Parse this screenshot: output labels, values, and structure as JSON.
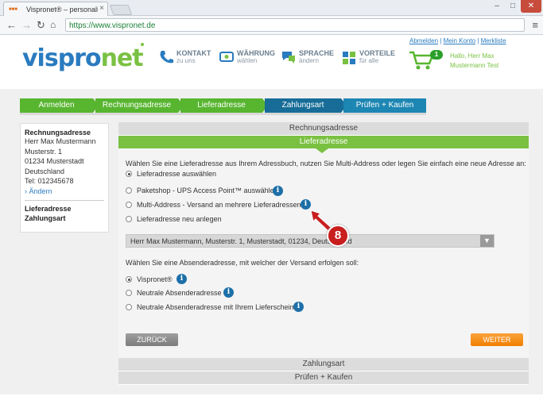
{
  "browser": {
    "tab_title": "Vispronet® – personalisi",
    "tab_favicon": "■■■",
    "url": "https://www.vispronet.de",
    "icons": {
      "back": "arrow-left-icon",
      "forward": "arrow-right-icon",
      "reload": "reload-icon",
      "home": "home-icon",
      "menu": "hamburger-menu-icon",
      "close_tab": "close-icon"
    }
  },
  "header": {
    "logo_vispro": "vispro",
    "logo_net": "net",
    "nav": [
      {
        "title": "KONTAKT",
        "sub": "zu uns",
        "icon": "phone-icon"
      },
      {
        "title": "WÄHRUNG",
        "sub": "wählen",
        "icon": "currency-icon"
      },
      {
        "title": "SPRACHE",
        "sub": "ändern",
        "icon": "language-icon"
      },
      {
        "title": "VORTEILE",
        "sub": "für alle",
        "icon": "advantages-icon"
      }
    ],
    "toplinks": [
      "Abmelden",
      "Mein Konto",
      "Merkliste"
    ],
    "toplink_sep": "|",
    "cart_count": "1",
    "greeting_line1": "Hallo, Herr Max",
    "greeting_line2": "Mustermann Test"
  },
  "steps": [
    "Anmelden",
    "Rechnungsadresse",
    "Lieferadresse",
    "Zahlungsart",
    "Prüfen + Kaufen"
  ],
  "sidebar": {
    "billing_title": "Rechnungsadresse",
    "billing_lines": [
      "Herr Max Mustermann",
      "Musterstr. 1",
      "01234 Musterstadt",
      "Deutschland",
      "Tel: 012345678"
    ],
    "change_link": "› Ändern",
    "delivery_title": "Lieferadresse",
    "payment_title": "Zahlungsart"
  },
  "panel": {
    "billing_head": "Rechnungsadresse",
    "delivery_head": "Lieferadresse",
    "intro": "Wählen Sie eine Lieferadresse aus Ihrem Adressbuch, nutzen Sie Multi-Address oder legen Sie einfach eine neue Adresse an:",
    "options": [
      {
        "label": "Lieferadresse auswählen",
        "selected": true,
        "info": false
      },
      {
        "label": "Paketshop - UPS Access Point™ auswählen",
        "selected": false,
        "info": true
      },
      {
        "label": "Multi-Address - Versand an mehrere Lieferadressen",
        "selected": false,
        "info": true
      },
      {
        "label": "Lieferadresse neu anlegen",
        "selected": false,
        "info": false
      }
    ],
    "select_value": "Herr Max Mustermann, Musterstr. 1, Musterstadt, 01234, Deutschland",
    "sender_intro": "Wählen Sie eine Absenderadresse, mit welcher der Versand erfolgen soll:",
    "sender_options": [
      {
        "label": "Vispronet®",
        "selected": true
      },
      {
        "label": "Neutrale Absenderadresse",
        "selected": false
      },
      {
        "label": "Neutrale Absenderadresse mit Ihrem Lieferschein",
        "selected": false
      }
    ],
    "back_label": "ZURÜCK",
    "next_label": "WEITER",
    "info_glyph": "i",
    "callout_number": "8"
  },
  "collapsed_sections": [
    "Zahlungsart",
    "Prüfen + Kaufen"
  ],
  "colors": {
    "brand_blue": "#2a7bbf",
    "brand_green": "#7ac143",
    "step_green": "#58b530",
    "step_blue": "#1d86b3",
    "cta_orange": "#f07f00",
    "callout_red": "#c81e1e"
  }
}
